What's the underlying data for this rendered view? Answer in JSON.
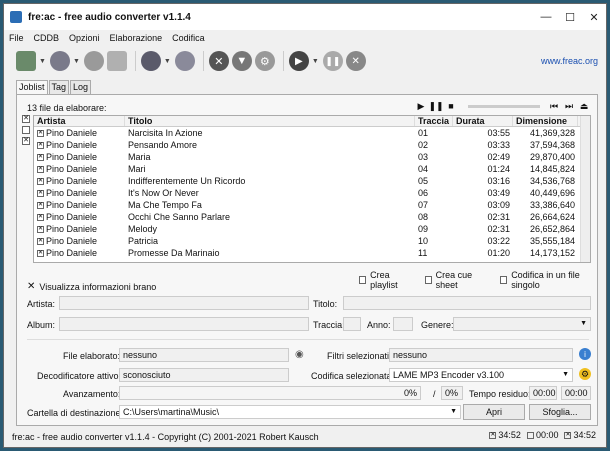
{
  "window": {
    "title": "fre:ac - free audio converter v1.1.4"
  },
  "menu": [
    "File",
    "CDDB",
    "Opzioni",
    "Elaborazione",
    "Codifica"
  ],
  "site_link": "www.freac.org",
  "tabs": [
    "Joblist",
    "Tag",
    "Log"
  ],
  "joblist": {
    "count_text": "13 file da elaborare:",
    "columns": [
      "Artista",
      "Titolo",
      "Traccia",
      "Durata",
      "Dimensione"
    ],
    "rows": [
      {
        "artist": "Pino Daniele",
        "title": "Narcisita In Azione",
        "track": "01",
        "duration": "03:55",
        "size": "41,369,328"
      },
      {
        "artist": "Pino Daniele",
        "title": "Pensando Amore",
        "track": "02",
        "duration": "03:33",
        "size": "37,594,368"
      },
      {
        "artist": "Pino Daniele",
        "title": "Maria",
        "track": "03",
        "duration": "02:49",
        "size": "29,870,400"
      },
      {
        "artist": "Pino Daniele",
        "title": "Mari",
        "track": "04",
        "duration": "01:24",
        "size": "14,845,824"
      },
      {
        "artist": "Pino Daniele",
        "title": "Indifferentemente Un Ricordo",
        "track": "05",
        "duration": "03:16",
        "size": "34,536,768"
      },
      {
        "artist": "Pino Daniele",
        "title": "It's Now Or Never",
        "track": "06",
        "duration": "03:49",
        "size": "40,449,696"
      },
      {
        "artist": "Pino Daniele",
        "title": "Ma Che Tempo Fa",
        "track": "07",
        "duration": "03:09",
        "size": "33,386,640"
      },
      {
        "artist": "Pino Daniele",
        "title": "Occhi Che Sanno Parlare",
        "track": "08",
        "duration": "02:31",
        "size": "26,664,624"
      },
      {
        "artist": "Pino Daniele",
        "title": "Melody",
        "track": "09",
        "duration": "02:31",
        "size": "26,652,864"
      },
      {
        "artist": "Pino Daniele",
        "title": "Patricia",
        "track": "10",
        "duration": "03:22",
        "size": "35,555,184"
      },
      {
        "artist": "Pino Daniele",
        "title": "Promesse Da Marinaio",
        "track": "11",
        "duration": "01:20",
        "size": "14,173,152"
      }
    ]
  },
  "options": {
    "create_playlist": "Crea playlist",
    "create_cue": "Crea cue sheet",
    "single_file": "Codifica in un file singolo"
  },
  "info": {
    "toggle": "Visualizza informazioni brano",
    "artist_label": "Artista:",
    "title_label": "Titolo:",
    "album_label": "Album:",
    "track_label": "Traccia:",
    "year_label": "Anno:",
    "genre_label": "Genere:"
  },
  "status_panel": {
    "file_label": "File elaborato:",
    "file_value": "nessuno",
    "filters_label": "Filtri selezionati:",
    "filters_value": "nessuno",
    "decoder_label": "Decodificatore attivo:",
    "decoder_value": "sconosciuto",
    "encoder_label": "Codifica selezionata:",
    "encoder_value": "LAME MP3 Encoder v3.100",
    "progress_label": "Avanzamento:",
    "progress_pct1": "0%",
    "progress_sep": "/",
    "progress_pct2": "0%",
    "time_label": "Tempo residuo:",
    "time1": "00:00",
    "time2": "00:00",
    "dest_label": "Cartella di destinazione:",
    "dest_value": "C:\\Users\\martina\\Music\\",
    "open_button": "Apri",
    "browse_button": "Sfoglia..."
  },
  "statusbar": {
    "text": "fre:ac - free audio converter v1.1.4 - Copyright (C) 2001-2021 Robert Kausch",
    "t1": "34:52",
    "t2": "00:00",
    "t3": "34:52"
  },
  "colors": {
    "link": "#1a4fb0",
    "accent": "#2b6db5"
  }
}
